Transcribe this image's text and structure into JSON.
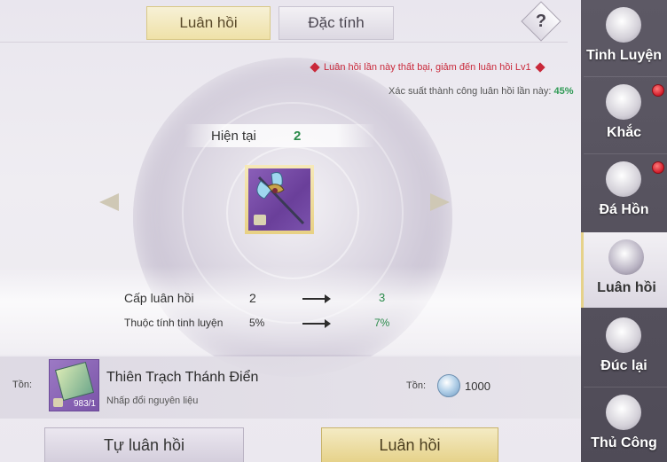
{
  "tabs": {
    "active_label": "Luân hồi",
    "inactive_label": "Đặc tính",
    "help_symbol": "?"
  },
  "notices": {
    "warning": "Luân hồi lần này thất bại, giảm đến luân hồi Lv1",
    "rate_prefix": "Xác suất thành công luân hồi lần này:",
    "rate_value": "45%"
  },
  "current": {
    "label": "Hiện tại",
    "value": "2"
  },
  "stats": [
    {
      "label": "Cấp luân hồi",
      "from": "2",
      "to": "3"
    },
    {
      "label": "Thuộc tính tinh luyện",
      "from": "5%",
      "to": "7%"
    }
  ],
  "material": {
    "stock_label": "Tồn:",
    "count": "983/1",
    "name": "Thiên Trạch Thánh Điển",
    "hint": "Nhấp đổi nguyên liệu",
    "coin_label": "Tồn:",
    "coin_value": "1000"
  },
  "buttons": {
    "auto": "Tự luân hồi",
    "main": "Luân hồi"
  },
  "sidenav": [
    {
      "label": "Tinh Luyện",
      "icon": "anvil-crest-icon",
      "badge": false,
      "active": false
    },
    {
      "label": "Khắc",
      "icon": "engrave-hammer-icon",
      "badge": true,
      "active": false
    },
    {
      "label": "Đá Hồn",
      "icon": "soul-stone-icon",
      "badge": true,
      "active": false
    },
    {
      "label": "Luân hồi",
      "icon": "reincarnation-sword-icon",
      "badge": false,
      "active": true
    },
    {
      "label": "Đúc lại",
      "icon": "recast-sword-icon",
      "badge": false,
      "active": false
    },
    {
      "label": "Thủ Công",
      "icon": "craft-hammer-icon",
      "badge": false,
      "active": false
    }
  ],
  "colors": {
    "accent_gold": "#e6d28a",
    "warning_red": "#c9283a",
    "success_green": "#2a8a4a",
    "sidenav_bg": "#5d5965"
  }
}
